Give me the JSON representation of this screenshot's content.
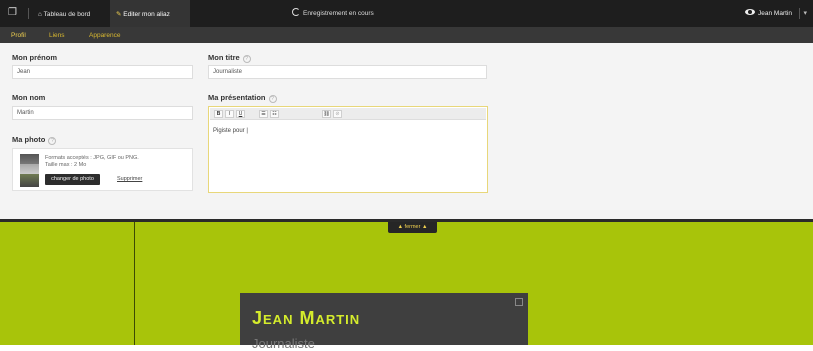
{
  "topbar": {
    "dashboard_label": "Tableau de bord",
    "edit_label": "Editer mon aliaz",
    "status_label": "Enregistrement en cours",
    "user_name": "Jean Martin"
  },
  "tabs": [
    {
      "label": "Profil",
      "active": true
    },
    {
      "label": "Liens",
      "active": false
    },
    {
      "label": "Apparence",
      "active": false
    }
  ],
  "form": {
    "firstname_label": "Mon prénom",
    "firstname_value": "Jean",
    "lastname_label": "Mon nom",
    "lastname_value": "Martin",
    "title_label": "Mon titre",
    "title_value": "Journaliste",
    "presentation_label": "Ma présentation",
    "presentation_value": "Pigiste pour |",
    "photo_label": "Ma photo",
    "photo_formats": "Formats acceptés : JPG, GIF ou PNG.",
    "photo_maxsize": "Taille max : 2 Mo",
    "change_photo_label": "changer de photo",
    "delete_photo_label": "Supprimer"
  },
  "editor_toolbar": [
    "B",
    "I",
    "U"
  ],
  "preview": {
    "close_label": "▲ fermer ▲",
    "name": "Jean Martin",
    "title": "Journaliste"
  },
  "colors": {
    "accent_green": "#a8c40a",
    "name_green": "#d5ec2c",
    "active_tab": "#f0d050",
    "tab": "#d8b830"
  }
}
